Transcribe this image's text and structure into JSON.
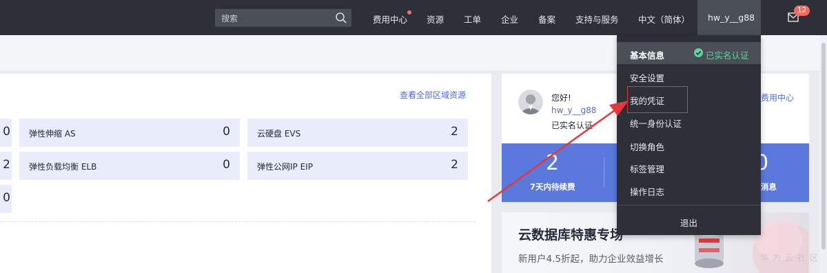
{
  "topbar": {
    "search_placeholder": "搜索",
    "nav": [
      "费用中心",
      "资源",
      "工单",
      "企业",
      "备案",
      "支持与服务",
      "中文（简体）"
    ],
    "user": "hw_y__g88",
    "mail_badge": "12",
    "accent_color": "#f26b5e"
  },
  "resources": {
    "view_all": "查看全部区域资源",
    "left_partial_values": [
      "0",
      "2",
      "0"
    ],
    "cards": [
      {
        "name": "弹性伸缩 AS",
        "value": "0"
      },
      {
        "name": "云硬盘 EVS",
        "value": "2"
      },
      {
        "name": "弹性负载均衡 ELB",
        "value": "0"
      },
      {
        "name": "弹性公网IP EIP",
        "value": "2"
      }
    ]
  },
  "account": {
    "greeting": "您好!",
    "username": "hw_y__g88",
    "verified": "已实名认证",
    "fee_center": "费用中心",
    "stats": [
      {
        "value": "2",
        "label": "7天内待续费"
      },
      {
        "value": "0",
        "label": "消息"
      }
    ]
  },
  "promo": {
    "title": "云数据库特惠专场",
    "subtitle": "新用户4.5折起，助力企业效益增长",
    "watermark": "华为云社区"
  },
  "dropdown": {
    "header": "基本信息",
    "verified": "已实名认证",
    "items": [
      "安全设置",
      "我的凭证",
      "统一身份认证",
      "切换角色",
      "标签管理",
      "操作日志"
    ],
    "logout": "退出",
    "verified_color": "#5fd39a",
    "highlight_color": "#e4393c"
  }
}
